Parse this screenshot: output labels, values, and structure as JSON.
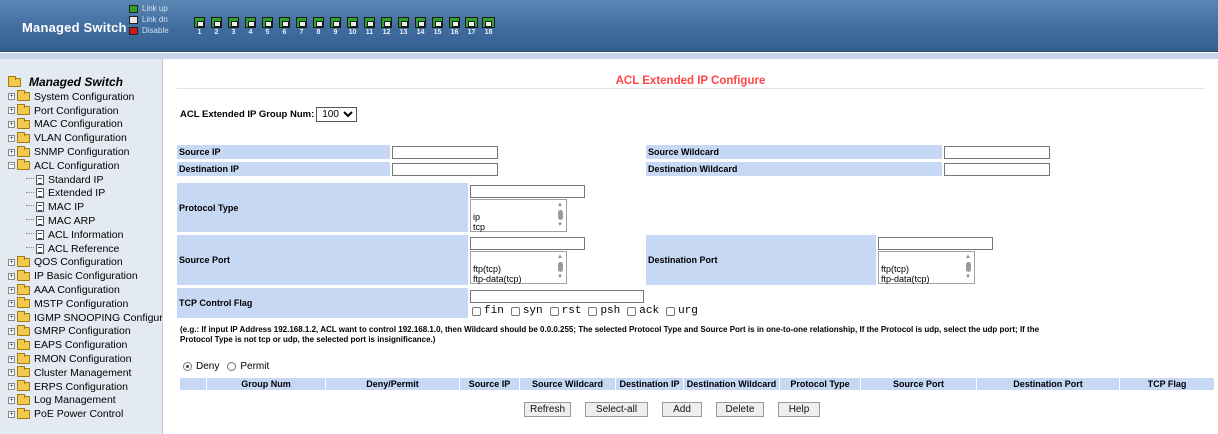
{
  "header": {
    "brand": "Managed Switch",
    "legend": {
      "link_up": "Link up",
      "link_dn": "Link dn",
      "disable": "Disable"
    },
    "ports": [
      "1",
      "2",
      "3",
      "4",
      "5",
      "6",
      "7",
      "8",
      "9",
      "10",
      "11",
      "12",
      "13",
      "14",
      "15",
      "16",
      "17",
      "18"
    ],
    "port_state": "link-up"
  },
  "sidebar": {
    "root": "Managed Switch",
    "items": [
      {
        "label": "System Configuration",
        "type": "folder",
        "expanded": false
      },
      {
        "label": "Port Configuration",
        "type": "folder",
        "expanded": false
      },
      {
        "label": "MAC Configuration",
        "type": "folder",
        "expanded": false
      },
      {
        "label": "VLAN Configuration",
        "type": "folder",
        "expanded": false
      },
      {
        "label": "SNMP Configuration",
        "type": "folder",
        "expanded": false
      },
      {
        "label": "ACL Configuration",
        "type": "folder",
        "expanded": true
      },
      {
        "label": "Standard IP",
        "type": "page"
      },
      {
        "label": "Extended IP",
        "type": "page"
      },
      {
        "label": "MAC IP",
        "type": "page"
      },
      {
        "label": "MAC ARP",
        "type": "page"
      },
      {
        "label": "ACL Information",
        "type": "page"
      },
      {
        "label": "ACL Reference",
        "type": "page"
      },
      {
        "label": "QOS Configuration",
        "type": "folder",
        "expanded": false
      },
      {
        "label": "IP Basic Configuration",
        "type": "folder",
        "expanded": false
      },
      {
        "label": "AAA Configuration",
        "type": "folder",
        "expanded": false
      },
      {
        "label": "MSTP Configuration",
        "type": "folder",
        "expanded": false
      },
      {
        "label": "IGMP SNOOPING Configuration",
        "type": "folder",
        "expanded": false
      },
      {
        "label": "GMRP Configuration",
        "type": "folder",
        "expanded": false
      },
      {
        "label": "EAPS Configuration",
        "type": "folder",
        "expanded": false
      },
      {
        "label": "RMON Configuration",
        "type": "folder",
        "expanded": false
      },
      {
        "label": "Cluster Management",
        "type": "folder",
        "expanded": false
      },
      {
        "label": "ERPS Configuration",
        "type": "folder",
        "expanded": false
      },
      {
        "label": "Log Management",
        "type": "folder",
        "expanded": false
      },
      {
        "label": "PoE Power Control",
        "type": "folder",
        "expanded": false
      }
    ]
  },
  "main": {
    "title": "ACL Extended IP Configure",
    "group_label": "ACL Extended IP Group Num:",
    "group_value": "100",
    "source_ip_label": "Source IP",
    "source_wildcard_label": "Source Wildcard",
    "dest_ip_label": "Destination IP",
    "dest_wildcard_label": "Destination Wildcard",
    "protocol_label": "Protocol Type",
    "protocol_options": [
      "ip",
      "tcp"
    ],
    "source_port_label": "Source Port",
    "source_port_options": [
      "ftp(tcp)",
      "ftp-data(tcp)"
    ],
    "dest_port_label": "Destination Port",
    "dest_port_options": [
      "ftp(tcp)",
      "ftp-data(tcp)"
    ],
    "tcp_flag_label": "TCP Control Flag",
    "tcp_flags": [
      "fin",
      "syn",
      "rst",
      "psh",
      "ack",
      "urg"
    ],
    "note": "(e.g.: If input IP Address 192.168.1.2, ACL want to control 192.168.1.0, then Wildcard should be 0.0.0.255; The selected Protocol Type and Source Port is in one-to-one relationship, If the Protocol is udp, select the udp port; If the Protocol Type is not tcp or udp, the selected port is insignificance.)",
    "radio_deny": "Deny",
    "radio_permit": "Permit",
    "radio_selected": "Deny",
    "table_headers": [
      "",
      "Group Num",
      "Deny/Permit",
      "Source IP",
      "Source Wildcard",
      "Destination IP",
      "Destination Wildcard",
      "Protocol Type",
      "Source Port",
      "Destination Port",
      "TCP Flag"
    ],
    "buttons": {
      "refresh": "Refresh",
      "select_all": "Select-all",
      "add": "Add",
      "delete": "Delete",
      "help": "Help"
    }
  }
}
